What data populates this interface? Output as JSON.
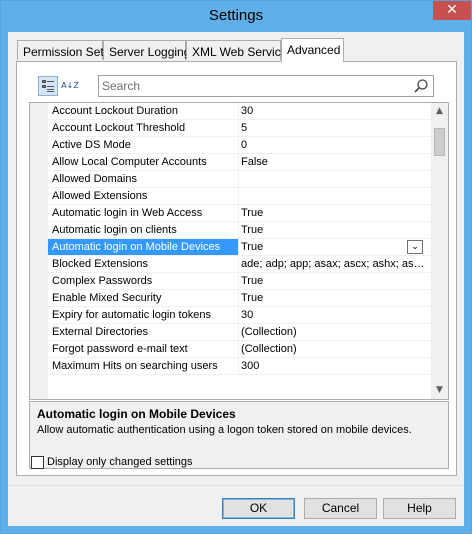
{
  "window": {
    "title": "Settings",
    "close_glyph": "✕"
  },
  "tabs": [
    {
      "label": "Permission Sets",
      "active": false
    },
    {
      "label": "Server Logging",
      "active": false
    },
    {
      "label": "XML Web Service",
      "active": false
    },
    {
      "label": "Advanced",
      "active": true
    }
  ],
  "toolbar": {
    "categorized_icon": "categorized-icon",
    "alphabetical_icon": "alphabetical-sort-icon",
    "alphabetical_glyph": "A↓Z",
    "search_placeholder": "Search",
    "search_value": ""
  },
  "grid": {
    "rows": [
      {
        "name": "Account Lockout Duration",
        "value": "30"
      },
      {
        "name": "Account Lockout Threshold",
        "value": "5"
      },
      {
        "name": "Active DS Mode",
        "value": "0"
      },
      {
        "name": "Allow Local Computer Accounts",
        "value": "False"
      },
      {
        "name": "Allowed Domains",
        "value": ""
      },
      {
        "name": "Allowed Extensions",
        "value": ""
      },
      {
        "name": "Automatic login in Web Access",
        "value": "True"
      },
      {
        "name": "Automatic login on clients",
        "value": "True"
      },
      {
        "name": "Automatic login on Mobile Devices",
        "value": "True",
        "selected": true
      },
      {
        "name": "Blocked Extensions",
        "value": "ade; adp; app; asax; ascx; ashx; as…"
      },
      {
        "name": "Complex Passwords",
        "value": "True"
      },
      {
        "name": "Enable Mixed Security",
        "value": "True"
      },
      {
        "name": "Expiry for automatic login tokens",
        "value": "30"
      },
      {
        "name": "External Directories",
        "value": "(Collection)"
      },
      {
        "name": "Forgot password e-mail text",
        "value": "(Collection)"
      },
      {
        "name": "Maximum Hits on searching users",
        "value": "300"
      }
    ],
    "dropdown_glyph": "⌄",
    "scroll_up_glyph": "▲",
    "scroll_down_glyph": "▼"
  },
  "help": {
    "title": "Automatic login on Mobile Devices",
    "description": "Allow automatic authentication using a logon token stored on mobile devices."
  },
  "options": {
    "changed_only_label": "Display only changed settings",
    "changed_only_checked": false
  },
  "buttons": {
    "ok": "OK",
    "cancel": "Cancel",
    "help": "Help"
  },
  "colors": {
    "titlebar": "#5fb0ea",
    "selection": "#3399ff",
    "close": "#c75050"
  }
}
